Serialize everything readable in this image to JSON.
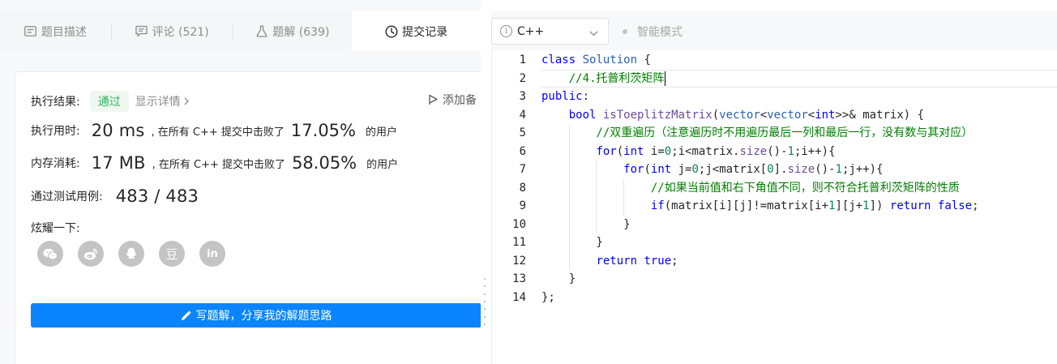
{
  "tabs": [
    {
      "label": "题目描述",
      "icon": "description-icon"
    },
    {
      "label": "评论 (521)",
      "icon": "comment-icon"
    },
    {
      "label": "题解 (639)",
      "icon": "flask-icon"
    },
    {
      "label": "提交记录",
      "icon": "clock-icon"
    }
  ],
  "result": {
    "label": "执行结果:",
    "status": "通过",
    "detail_link": "显示详情",
    "add_note": "添加备"
  },
  "runtime": {
    "label": "执行用时:",
    "value": "20 ms",
    "middle": ", 在所有 C++ 提交中击败了",
    "percent": "17.05%",
    "suffix": "的用户"
  },
  "memory": {
    "label": "内存消耗:",
    "value": "17 MB",
    "middle": ", 在所有 C++ 提交中击败了",
    "percent": "58.05%",
    "suffix": "的用户"
  },
  "tests": {
    "label": "通过测试用例:",
    "value": "483 / 483"
  },
  "share": {
    "label": "炫耀一下:",
    "buttons": [
      "wechat-icon",
      "weibo-icon",
      "qq-icon",
      "douban-icon",
      "linkedin-icon"
    ],
    "douban_glyph": "豆",
    "linkedin_glyph": "in"
  },
  "write_solution": "写题解，分享我的解题思路",
  "editor": {
    "language": "C++",
    "smart_mode": "智能模式",
    "line_numbers": [
      "1",
      "2",
      "3",
      "4",
      "5",
      "6",
      "7",
      "8",
      "9",
      "10",
      "11",
      "12",
      "13",
      "14"
    ],
    "current_line": 2,
    "lines": [
      "class Solution {",
      "    //4.托普利茨矩阵",
      "public:",
      "    bool isToeplitzMatrix(vector<vector<int>>& matrix) {",
      "        //双重遍历（注意遍历时不用遍历最后一列和最后一行，没有数与其对应）",
      "        for(int i=0;i<matrix.size()-1;i++){",
      "            for(int j=0;j<matrix[0].size()-1;j++){",
      "                //如果当前值和右下角值不同，则不符合托普利茨矩阵的性质",
      "                if(matrix[i][j]!=matrix[i+1][j+1]) return false;",
      "            }",
      "        }",
      "        return true;",
      "    }",
      "};"
    ]
  },
  "colors": {
    "accent": "#0a84ff",
    "pass": "#2db55d",
    "keyword": "#0000ff",
    "comment": "#008000",
    "number": "#098658"
  }
}
